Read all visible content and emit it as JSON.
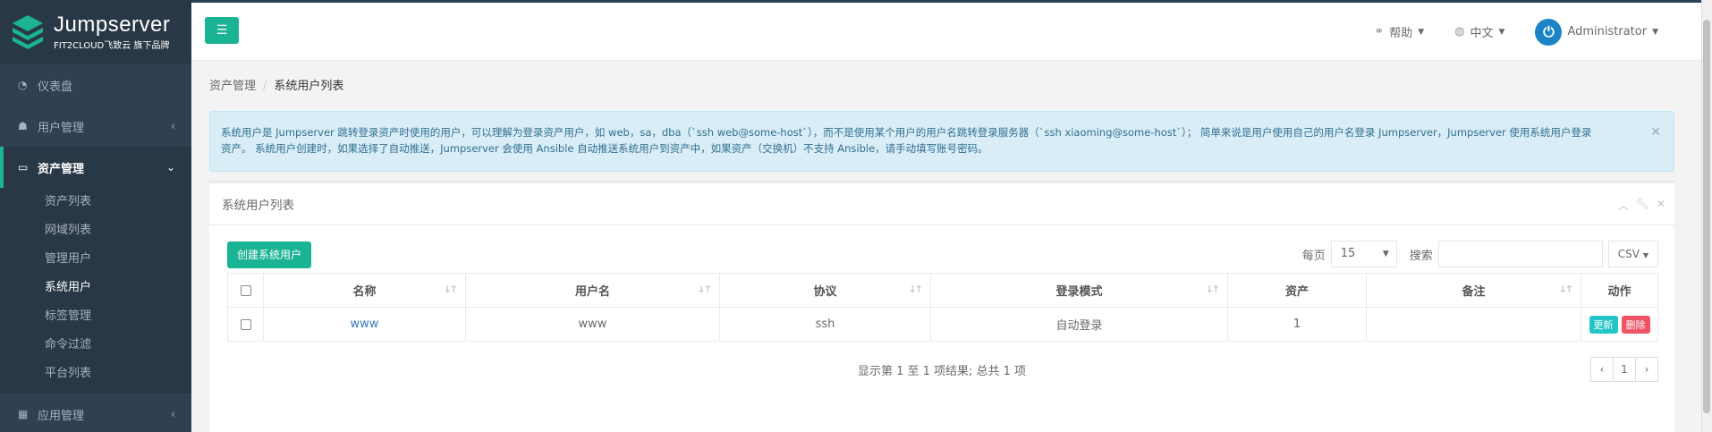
{
  "brand": {
    "name": "Jumpserver",
    "subtitle": "FIT2CLOUD飞致云 旗下品牌"
  },
  "sidebar": {
    "items": [
      {
        "label": "仪表盘",
        "icon": "dashboard-icon"
      },
      {
        "label": "用户管理",
        "icon": "users-icon"
      },
      {
        "label": "资产管理",
        "icon": "inbox-icon"
      },
      {
        "label": "应用管理",
        "icon": "grid-icon"
      }
    ],
    "subitems": [
      "资产列表",
      "网域列表",
      "管理用户",
      "系统用户",
      "标签管理",
      "命令过滤",
      "平台列表"
    ],
    "active_sub": "系统用户"
  },
  "topbar": {
    "help": "帮助",
    "language": "中文",
    "user": "Administrator"
  },
  "breadcrumb": {
    "parent": "资产管理",
    "current": "系统用户列表"
  },
  "alert": {
    "line1": "系统用户是 Jumpserver 跳转登录资产时使用的用户，可以理解为登录资产用户，如 web，sa，dba（`ssh web@some-host`），而不是使用某个用户的用户名跳转登录服务器（`ssh xiaoming@some-host`）； 简单来说是用户使用自己的用户名登录 Jumpserver，Jumpserver 使用系统用户登录",
    "line2": "资产。 系统用户创建时，如果选择了自动推送，Jumpserver 会使用 Ansible 自动推送系统用户到资产中，如果资产（交换机）不支持 Ansible，请手动填写账号密码。"
  },
  "panel": {
    "title": "系统用户列表",
    "create_label": "创建系统用户",
    "per_page_label": "每页",
    "per_page_value": "15",
    "search_label": "搜索",
    "csv_label": "CSV"
  },
  "table": {
    "headers": [
      "名称",
      "用户名",
      "协议",
      "登录模式",
      "资产",
      "备注",
      "动作"
    ],
    "rows": [
      {
        "name": "www",
        "username": "www",
        "protocol": "ssh",
        "login_mode": "自动登录",
        "assets": "1",
        "comment": "",
        "update": "更新",
        "delete": "删除"
      }
    ]
  },
  "footer": {
    "info": "显示第 1 至 1 项结果; 总共 1 项",
    "prev": "‹",
    "page": "1",
    "next": "›"
  },
  "colors": {
    "primary": "#1ab394",
    "sidebar": "#2f4050",
    "info": "#23c6c8",
    "danger": "#ed5565"
  }
}
